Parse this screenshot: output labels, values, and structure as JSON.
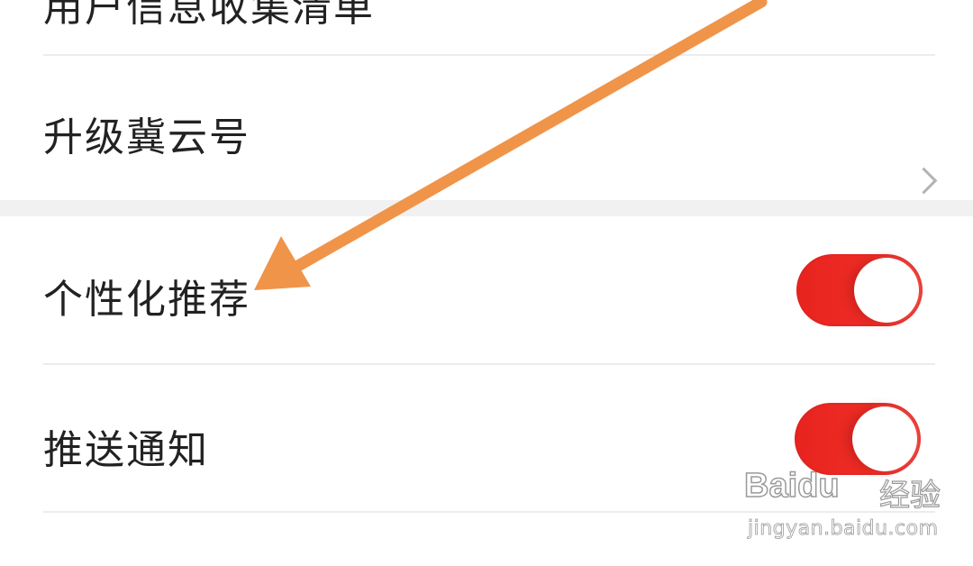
{
  "settings": {
    "top_partial_label": "用户信息收集清单",
    "items": [
      {
        "label": "升级冀云号",
        "control": "chevron-right"
      },
      {
        "label": "个性化推荐",
        "control": "toggle",
        "state": "on"
      },
      {
        "label": "推送通知",
        "control": "toggle",
        "state": "on"
      }
    ]
  },
  "colors": {
    "toggle_on": "#ee2d25",
    "annotation_arrow": "#f0944a",
    "divider": "#ececec",
    "section_gap": "#f1f1f1"
  },
  "watermark": {
    "logo": "Baidu",
    "suffix": "经验",
    "url": "jingyan.baidu.com"
  }
}
